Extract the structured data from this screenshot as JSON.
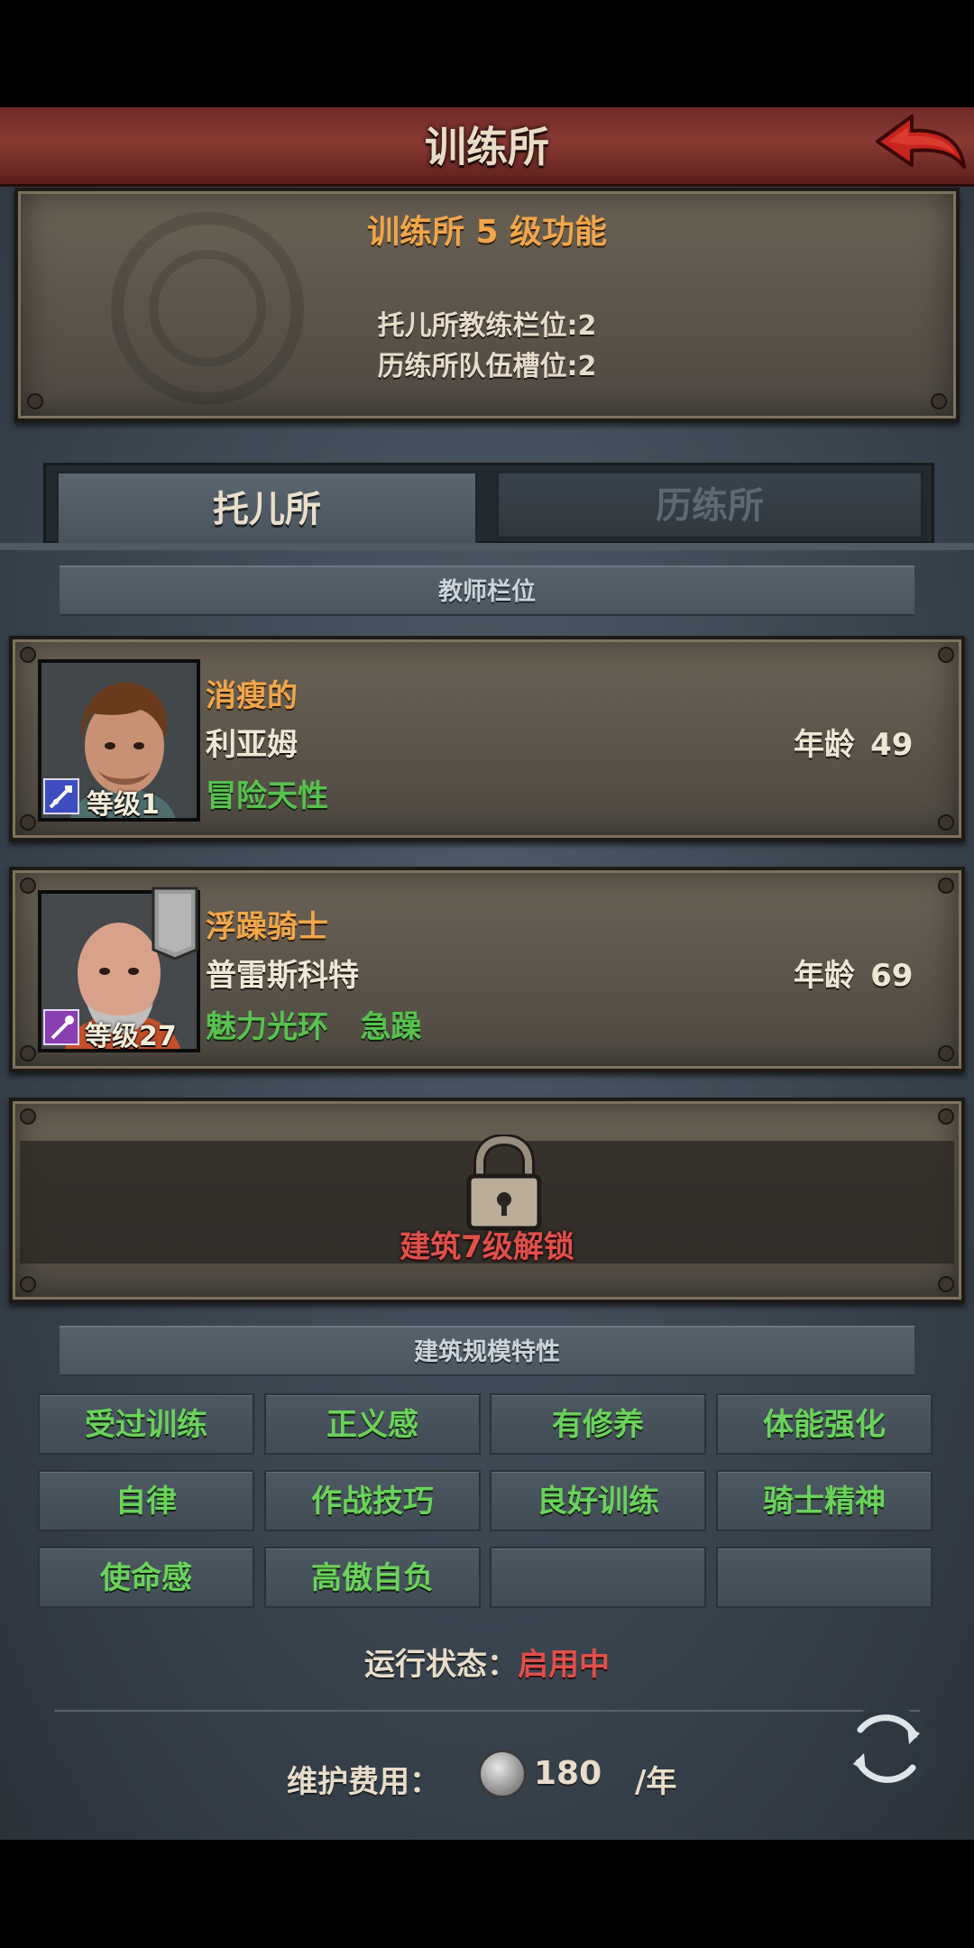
{
  "header": {
    "title": "训练所"
  },
  "info_panel": {
    "title": "训练所 5 级功能",
    "lines": [
      "托儿所教练栏位:2",
      "历练所队伍槽位:2"
    ]
  },
  "tabs": [
    {
      "label": "托儿所",
      "active": true
    },
    {
      "label": "历练所",
      "active": false
    }
  ],
  "teacher_section": {
    "label": "教师栏位"
  },
  "teachers": [
    {
      "title": "消瘦的",
      "name": "利亚姆",
      "traits": "冒险天性",
      "age_label": "年龄",
      "age": "49",
      "level": "等级1",
      "class_icon": "sword-icon",
      "class_color": "#3b4dbf"
    },
    {
      "title": "浮躁骑士",
      "name": "普雷斯科特",
      "traits": "魅力光环   急躁",
      "age_label": "年龄",
      "age": "69",
      "level": "等级27",
      "class_icon": "staff-icon",
      "class_color": "#8a3fb0"
    }
  ],
  "locked_slot": {
    "text": "建筑7级解锁",
    "icon": "padlock-icon"
  },
  "features_section": {
    "label": "建筑规模特性"
  },
  "features": [
    "受过训练",
    "正义感",
    "有修养",
    "体能强化",
    "自律",
    "作战技巧",
    "良好训练",
    "骑士精神",
    "使命感",
    "高傲自负",
    "",
    ""
  ],
  "status": {
    "label": "运行状态：",
    "value": "启用中",
    "value_color": "#e0504a"
  },
  "fee": {
    "label": "维护费用：",
    "amount": "180",
    "unit": "/年",
    "icon": "silver-coin-icon"
  },
  "colors": {
    "accent_orange": "#f0a64a",
    "trait_green": "#58c24f",
    "title_red": "#8a3a33"
  }
}
